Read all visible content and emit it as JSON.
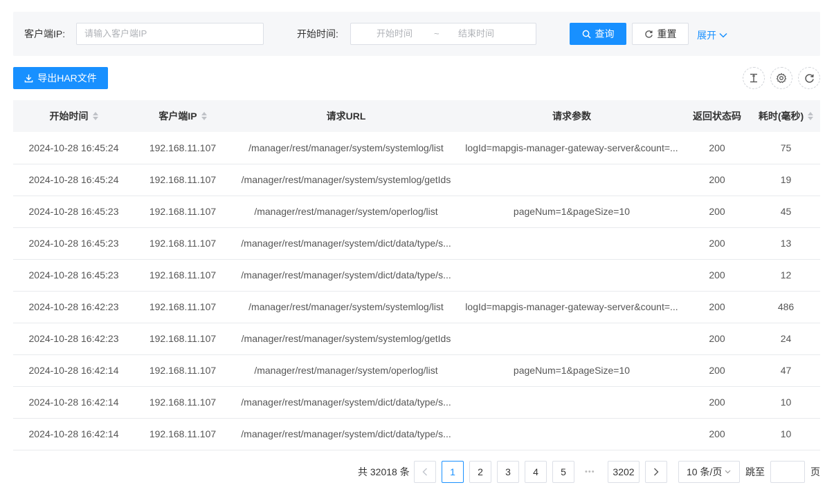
{
  "filters": {
    "client_ip_label": "客户端IP:",
    "client_ip_placeholder": "请输入客户端IP",
    "start_time_label": "开始时间:",
    "range_start_placeholder": "开始时间",
    "range_separator": "~",
    "range_end_placeholder": "结束时间",
    "search_label": "查询",
    "reset_label": "重置",
    "expand_label": "展开"
  },
  "toolbar": {
    "export_label": "导出HAR文件"
  },
  "colors": {
    "primary": "#1890ff",
    "border": "#dcdfe6",
    "header_bg": "#f5f6f8",
    "filter_bg": "#f6f7f9"
  },
  "table": {
    "columns": [
      "开始时间",
      "客户端IP",
      "请求URL",
      "请求参数",
      "返回状态码",
      "耗时(毫秒)"
    ],
    "rows": [
      [
        "2024-10-28 16:45:24",
        "192.168.11.107",
        "/manager/rest/manager/system/systemlog/list",
        "logId=mapgis-manager-gateway-server&count=...",
        "200",
        "75"
      ],
      [
        "2024-10-28 16:45:24",
        "192.168.11.107",
        "/manager/rest/manager/system/systemlog/getIds",
        "",
        "200",
        "19"
      ],
      [
        "2024-10-28 16:45:23",
        "192.168.11.107",
        "/manager/rest/manager/system/operlog/list",
        "pageNum=1&pageSize=10",
        "200",
        "45"
      ],
      [
        "2024-10-28 16:45:23",
        "192.168.11.107",
        "/manager/rest/manager/system/dict/data/type/s...",
        "",
        "200",
        "13"
      ],
      [
        "2024-10-28 16:45:23",
        "192.168.11.107",
        "/manager/rest/manager/system/dict/data/type/s...",
        "",
        "200",
        "12"
      ],
      [
        "2024-10-28 16:42:23",
        "192.168.11.107",
        "/manager/rest/manager/system/systemlog/list",
        "logId=mapgis-manager-gateway-server&count=...",
        "200",
        "486"
      ],
      [
        "2024-10-28 16:42:23",
        "192.168.11.107",
        "/manager/rest/manager/system/systemlog/getIds",
        "",
        "200",
        "24"
      ],
      [
        "2024-10-28 16:42:14",
        "192.168.11.107",
        "/manager/rest/manager/system/operlog/list",
        "pageNum=1&pageSize=10",
        "200",
        "47"
      ],
      [
        "2024-10-28 16:42:14",
        "192.168.11.107",
        "/manager/rest/manager/system/dict/data/type/s...",
        "",
        "200",
        "10"
      ],
      [
        "2024-10-28 16:42:14",
        "192.168.11.107",
        "/manager/rest/manager/system/dict/data/type/s...",
        "",
        "200",
        "10"
      ]
    ]
  },
  "pagination": {
    "total_text": "共 32018 条",
    "pages": [
      "1",
      "2",
      "3",
      "4",
      "5"
    ],
    "ellipsis": "•••",
    "last_page": "3202",
    "page_size_text": "10 条/页",
    "jump_prefix": "跳至",
    "jump_suffix": "页",
    "current_page": 1
  }
}
